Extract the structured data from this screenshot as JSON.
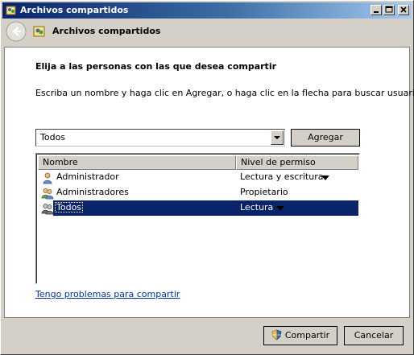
{
  "window": {
    "title": "Archivos compartidos"
  },
  "nav": {
    "title": "Archivos compartidos"
  },
  "content": {
    "heading": "Elija a las personas con las que desea compartir",
    "instructions": "Escriba un nombre y haga clic en Agregar, o haga clic en la flecha para buscar usuarios"
  },
  "user_select": {
    "value": "Todos"
  },
  "buttons": {
    "add_label": "Agregar",
    "share_label": "Compartir",
    "cancel_label": "Cancelar"
  },
  "table": {
    "columns": [
      "Nombre",
      "Nivel de permiso"
    ],
    "rows": [
      {
        "name": "Administrador",
        "permission": "Lectura y escritura",
        "icon": "user-icon",
        "has_dropdown": true,
        "selected": false
      },
      {
        "name": "Administradores",
        "permission": "Propietario",
        "icon": "group-icon",
        "has_dropdown": false,
        "selected": false
      },
      {
        "name": "Todos",
        "permission": "Lectura",
        "icon": "group-icon",
        "has_dropdown": true,
        "selected": true
      }
    ]
  },
  "help_link": "Tengo problemas para compartir",
  "colors": {
    "titlebar_start": "#0a246a",
    "titlebar_end": "#a6caf0",
    "selection": "#0a246a",
    "link": "#0033aa",
    "face": "#d4d0c8"
  }
}
